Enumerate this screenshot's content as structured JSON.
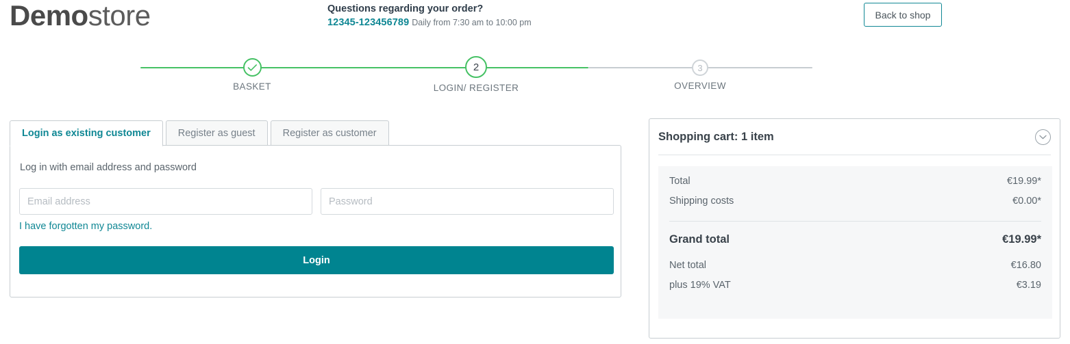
{
  "header": {
    "logo_bold": "Demo",
    "logo_light": "store",
    "contact_title": "Questions regarding your order?",
    "contact_phone": "12345-123456789",
    "contact_hours": "Daily from 7:30 am to 10:00 pm",
    "back_to_shop_label": "Back to shop"
  },
  "stepper": {
    "steps": [
      {
        "label": "BASKET",
        "marker": "check-icon",
        "state": "done"
      },
      {
        "label": "LOGIN/ REGISTER",
        "marker": "2",
        "state": "active"
      },
      {
        "label": "OVERVIEW",
        "marker": "3",
        "state": "todo"
      }
    ]
  },
  "tabs": [
    {
      "label": "Login as existing customer",
      "active": true
    },
    {
      "label": "Register as guest",
      "active": false
    },
    {
      "label": "Register as customer",
      "active": false
    }
  ],
  "login_form": {
    "hint": "Log in with email address and password",
    "email_placeholder": "Email address",
    "email_value": "",
    "password_placeholder": "Password",
    "password_value": "",
    "forgot_password_label": "I have forgotten my password.",
    "submit_label": "Login"
  },
  "cart": {
    "title": "Shopping cart: 1 item",
    "collapse_icon": "chevron-down-icon",
    "rows": [
      {
        "label": "Total",
        "value": "€19.99*"
      },
      {
        "label": "Shipping costs",
        "value": "€0.00*"
      }
    ],
    "grand_total": {
      "label": "Grand total",
      "value": "€19.99*"
    },
    "tax_rows": [
      {
        "label": "Net total",
        "value": "€16.80"
      },
      {
        "label": "plus 19% VAT",
        "value": "€3.19"
      }
    ]
  },
  "colors": {
    "accent_teal": "#008490",
    "link_teal": "#0f8794",
    "step_green": "#45c164",
    "text_dark": "#39424a",
    "text_muted": "#6b757d",
    "panel_bg": "#f6f7f8"
  }
}
